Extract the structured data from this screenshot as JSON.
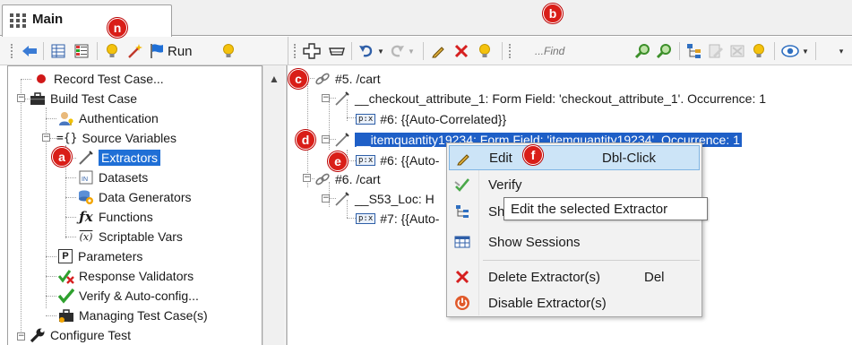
{
  "tab": {
    "label": "Main"
  },
  "left_toolbar": {
    "run_label": "Run"
  },
  "right_toolbar": {
    "find_placeholder": "...Find"
  },
  "left_tree": {
    "items": [
      {
        "label": "Record Test Case..."
      },
      {
        "label": "Build Test Case"
      },
      {
        "label": "Authentication"
      },
      {
        "label": "Source Variables"
      },
      {
        "label": "Extractors"
      },
      {
        "label": "Datasets"
      },
      {
        "label": "Data Generators"
      },
      {
        "label": "Functions"
      },
      {
        "label": "Scriptable Vars"
      },
      {
        "label": "Parameters"
      },
      {
        "label": "Response Validators"
      },
      {
        "label": "Verify & Auto-config..."
      },
      {
        "label": "Managing Test Case(s)"
      },
      {
        "label": "Configure Test"
      }
    ],
    "source_vars_prefix": "={}",
    "datasets_icon_text": "IN",
    "scriptable_icon_text": "(x)",
    "parameters_icon_text": "P"
  },
  "right_tree": {
    "nodes": [
      {
        "label": "#5. /cart"
      },
      {
        "label": "__checkout_attribute_1: Form Field: 'checkout_attribute_1'. Occurrence: 1"
      },
      {
        "label": "#6: {{Auto-Correlated}}"
      },
      {
        "label": "__itemquantity19234: Form Field: 'itemquantity19234'. Occurrence: 1"
      },
      {
        "label": "#6: {{Auto-"
      },
      {
        "label": "#6. /cart"
      },
      {
        "label": "__S53_Loc: H"
      },
      {
        "label": "#7: {{Auto-"
      }
    ],
    "px_icon_text": "p:x"
  },
  "context_menu": {
    "items": [
      {
        "label": "Edit",
        "shortcut": "Dbl-Click"
      },
      {
        "label": "Verify",
        "shortcut": ""
      },
      {
        "label": "Show ",
        "shortcut": ""
      },
      {
        "label": "Show Sessions",
        "shortcut": ""
      },
      {
        "label": "Delete Extractor(s)",
        "shortcut": "Del"
      },
      {
        "label": "Disable Extractor(s)",
        "shortcut": ""
      }
    ]
  },
  "tooltip": {
    "text": "Edit the selected Extractor"
  },
  "badges": {
    "a": "a",
    "b": "b",
    "c": "c",
    "d": "d",
    "e": "e",
    "f": "f",
    "n": "n"
  },
  "colors": {
    "badge_red": "#d91e18",
    "selection_blue": "#1e5fc7",
    "menu_hover": "#cce4f7"
  }
}
